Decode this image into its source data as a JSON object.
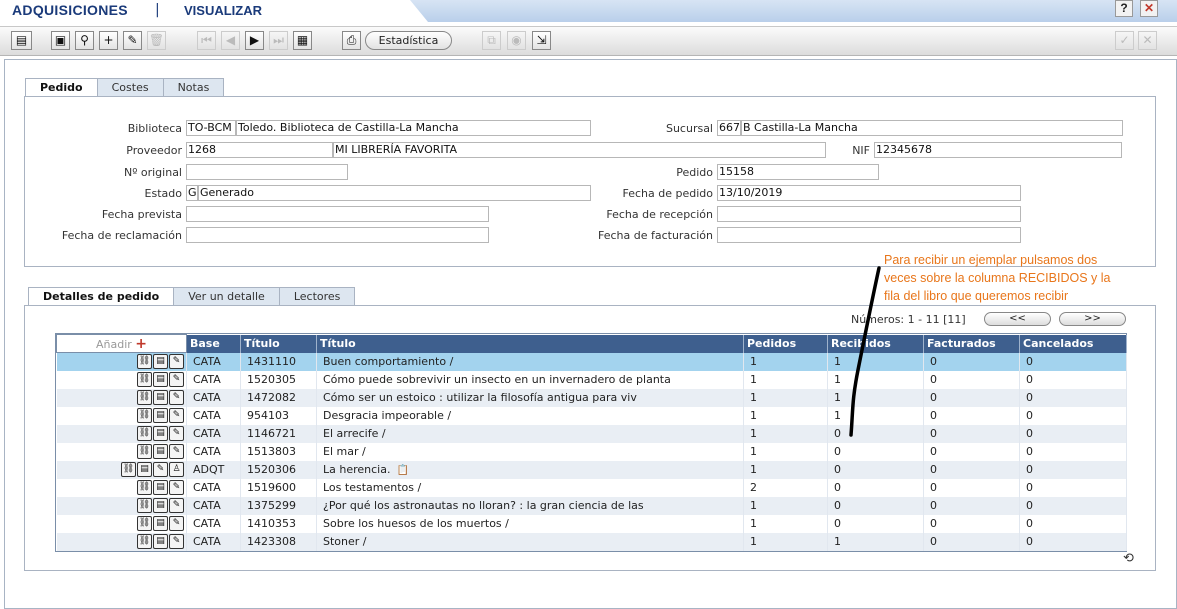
{
  "app": {
    "title": "ADQUISICIONES",
    "separator": "|",
    "mode": "VISUALIZAR",
    "help_label": "?",
    "close_label": "✕"
  },
  "toolbar": {
    "stats_label": "Estadística"
  },
  "header_tabs": [
    "Pedido",
    "Costes",
    "Notas"
  ],
  "form": {
    "biblioteca_label": "Biblioteca",
    "biblioteca_code": "TO-BCM",
    "biblioteca_name": "Toledo. Biblioteca de Castilla-La Mancha",
    "sucursal_label": "Sucursal",
    "sucursal_code": "667",
    "sucursal_name": "B Castilla-La Mancha",
    "proveedor_label": "Proveedor",
    "proveedor_code": "1268",
    "proveedor_name": "MI LIBRERÍA FAVORITA",
    "nif_label": "NIF",
    "nif": "12345678",
    "original_label": "Nº original",
    "original": "",
    "pedido_label": "Pedido",
    "pedido": "15158",
    "estado_label": "Estado",
    "estado_code": "G",
    "estado_name": "Generado",
    "fecha_pedido_label": "Fecha de pedido",
    "fecha_pedido": "13/10/2019",
    "fecha_prevista_label": "Fecha prevista",
    "fecha_prevista": "",
    "fecha_recepcion_label": "Fecha de recepción",
    "fecha_recepcion": "",
    "fecha_reclamacion_label": "Fecha de reclamación",
    "fecha_reclamacion": "",
    "fecha_facturacion_label": "Fecha de facturación",
    "fecha_facturacion": ""
  },
  "detail_tabs": [
    "Detalles de pedido",
    "Ver un detalle",
    "Lectores"
  ],
  "annotation": [
    "Para recibir  un ejemplar pulsamos dos",
    "veces sobre la columna RECIBIDOS y la",
    "fila del libro que queremos recibir"
  ],
  "pager": {
    "numeros": "Números: 1 - 11 [11]",
    "prev": "<<",
    "next": ">>"
  },
  "table": {
    "add_label": "Añadir",
    "add_plus": "+",
    "columns": [
      "Base",
      "Título",
      "Título",
      "Pedidos",
      "Recibidos",
      "Facturados",
      "Cancelados"
    ],
    "rows": [
      [
        "CATA",
        "1431110",
        "Buen comportamiento /",
        "1",
        "1",
        "0",
        "0"
      ],
      [
        "CATA",
        "1520305",
        "Cómo puede sobrevivir un insecto en un invernadero de planta",
        "1",
        "1",
        "0",
        "0"
      ],
      [
        "CATA",
        "1472082",
        "Cómo ser un estoico : utilizar la filosofía antigua para viv",
        "1",
        "1",
        "0",
        "0"
      ],
      [
        "CATA",
        "954103",
        "Desgracia impeorable /",
        "1",
        "1",
        "0",
        "0"
      ],
      [
        "CATA",
        "1146721",
        "El arrecife /",
        "1",
        "0",
        "0",
        "0"
      ],
      [
        "CATA",
        "1513803",
        "El mar /",
        "1",
        "0",
        "0",
        "0"
      ],
      [
        "ADQT",
        "1520306",
        "La herencia.",
        "1",
        "0",
        "0",
        "0"
      ],
      [
        "CATA",
        "1519600",
        "Los testamentos /",
        "2",
        "0",
        "0",
        "0"
      ],
      [
        "CATA",
        "1375299",
        "¿Por qué los astronautas no lloran? : la gran ciencia de las",
        "1",
        "0",
        "0",
        "0"
      ],
      [
        "CATA",
        "1410353",
        "Sobre los huesos de los muertos /",
        "1",
        "0",
        "0",
        "0"
      ],
      [
        "CATA",
        "1423308",
        "Stoner /",
        "1",
        "1",
        "0",
        "0"
      ]
    ]
  }
}
